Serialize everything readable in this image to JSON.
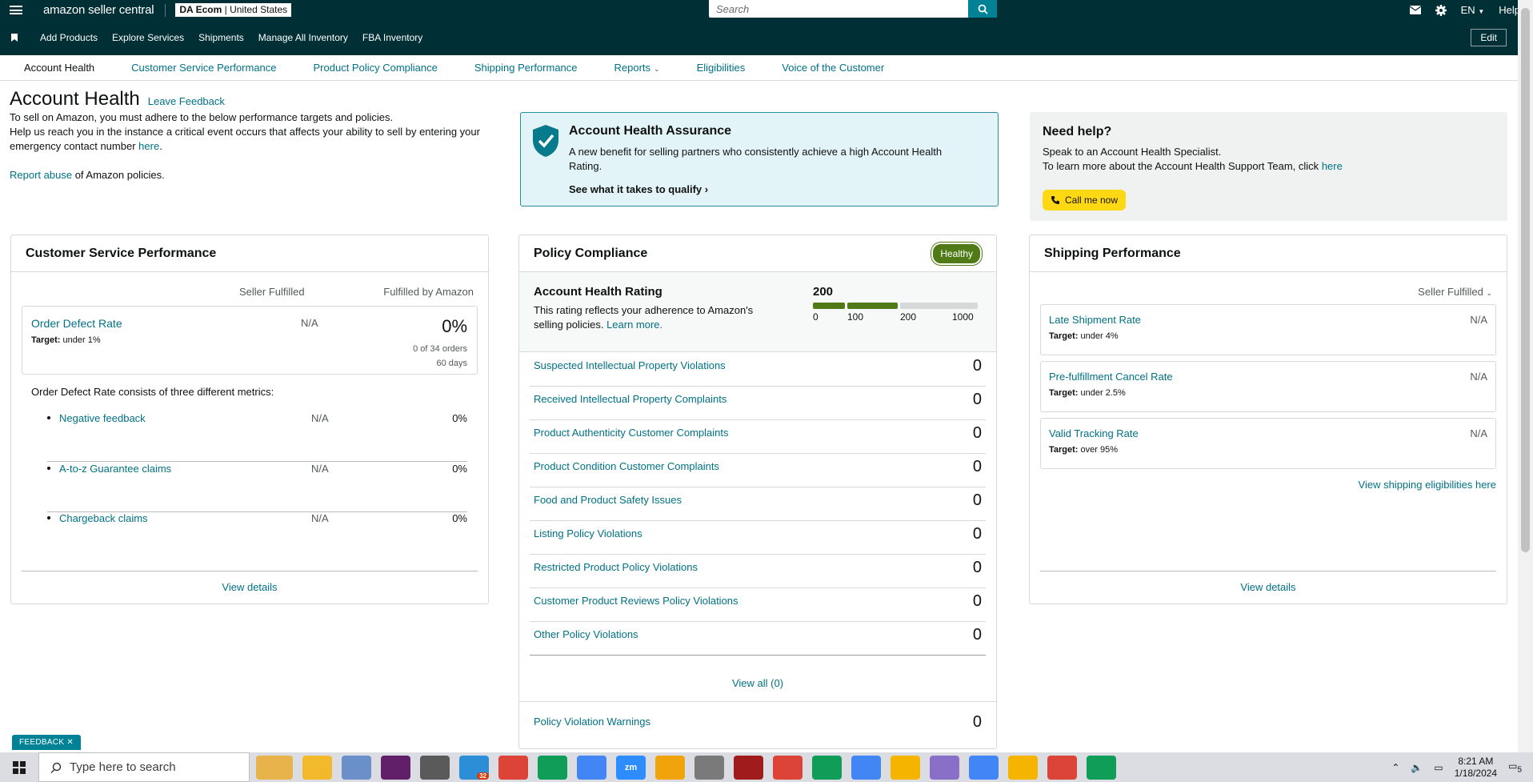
{
  "header": {
    "logo_text": "amazon seller central",
    "account": "DA Ecom",
    "marketplace": "United States",
    "search_placeholder": "Search",
    "lang": "EN",
    "help": "Help"
  },
  "nav": {
    "items": [
      "Add Products",
      "Explore Services",
      "Shipments",
      "Manage All Inventory",
      "FBA Inventory"
    ],
    "edit": "Edit"
  },
  "tabs": [
    "Account Health",
    "Customer Service Performance",
    "Product Policy Compliance",
    "Shipping Performance",
    "Reports",
    "Eligibilities",
    "Voice of the Customer"
  ],
  "intro": {
    "title": "Account Health",
    "leave_feedback": "Leave Feedback",
    "line1": "To sell on Amazon, you must adhere to the below performance targets and policies.",
    "line2": "Help us reach you in the instance a critical event occurs that affects your ability to sell by entering your emergency contact number",
    "here": "here",
    "report_abuse": "Report abuse",
    "report_rest": "of Amazon policies."
  },
  "aha": {
    "title": "Account Health Assurance",
    "text": "A new benefit for selling partners who consistently achieve a high Account Health Rating.",
    "link": "See what it takes to qualify"
  },
  "help_box": {
    "title": "Need help?",
    "line1": "Speak to an Account Health Specialist.",
    "line2": "To learn more about the Account Health Support Team, click",
    "here": "here",
    "call": "Call me now"
  },
  "csp": {
    "title": "Customer Service Performance",
    "col1": "Seller Fulfilled",
    "col2": "Fulfilled by Amazon",
    "odr": {
      "name": "Order Defect Rate",
      "target_label": "Target:",
      "target": "under 1%",
      "sf": "N/A",
      "fba": "0%",
      "orders": "0 of 34 orders",
      "days": "60 days"
    },
    "consists": "Order Defect Rate consists of three different metrics:",
    "metrics": [
      {
        "name": "Negative feedback",
        "sf": "N/A",
        "fba": "0%"
      },
      {
        "name": "A-to-z Guarantee claims",
        "sf": "N/A",
        "fba": "0%"
      },
      {
        "name": "Chargeback claims",
        "sf": "N/A",
        "fba": "0%"
      }
    ],
    "view": "View details"
  },
  "pc": {
    "title": "Policy Compliance",
    "status": "Healthy",
    "ahr_title": "Account Health Rating",
    "ahr_text": "This rating reflects your adherence to Amazon's selling policies.",
    "learn": "Learn more.",
    "score": "200",
    "score_value": 200,
    "ticks": [
      "0",
      "100",
      "200",
      "1000"
    ],
    "rows": [
      {
        "name": "Suspected Intellectual Property Violations",
        "value": "0"
      },
      {
        "name": "Received Intellectual Property Complaints",
        "value": "0"
      },
      {
        "name": "Product Authenticity Customer Complaints",
        "value": "0"
      },
      {
        "name": "Product Condition Customer Complaints",
        "value": "0"
      },
      {
        "name": "Food and Product Safety Issues",
        "value": "0"
      },
      {
        "name": "Listing Policy Violations",
        "value": "0"
      },
      {
        "name": "Restricted Product Policy Violations",
        "value": "0"
      },
      {
        "name": "Customer Product Reviews Policy Violations",
        "value": "0"
      },
      {
        "name": "Other Policy Violations",
        "value": "0"
      }
    ],
    "view_all": "View all (0)",
    "warnings": {
      "name": "Policy Violation Warnings",
      "value": "0"
    },
    "colors": {
      "bar_fill": "#4f7a15",
      "bar_empty": "#d5d9d9"
    }
  },
  "sp": {
    "title": "Shipping Performance",
    "filter": "Seller Fulfilled",
    "rows": [
      {
        "name": "Late Shipment Rate",
        "target_label": "Target:",
        "target": "under 4%",
        "value": "N/A"
      },
      {
        "name": "Pre-fulfillment Cancel Rate",
        "target_label": "Target:",
        "target": "under 2.5%",
        "value": "N/A"
      },
      {
        "name": "Valid Tracking Rate",
        "target_label": "Target:",
        "target": "over 95%",
        "value": "N/A"
      }
    ],
    "elig": "View shipping eligibilities here",
    "view": "View details"
  },
  "feedback_tab": "FEEDBACK",
  "taskbar": {
    "search": "Type here to search",
    "time": "8:21 AM",
    "date": "1/18/2024",
    "notif": "5",
    "badge": "32"
  },
  "colors": {
    "teal_dark": "#002f36",
    "link": "#007185",
    "accent": "#008296",
    "yellow": "#ffd814"
  }
}
